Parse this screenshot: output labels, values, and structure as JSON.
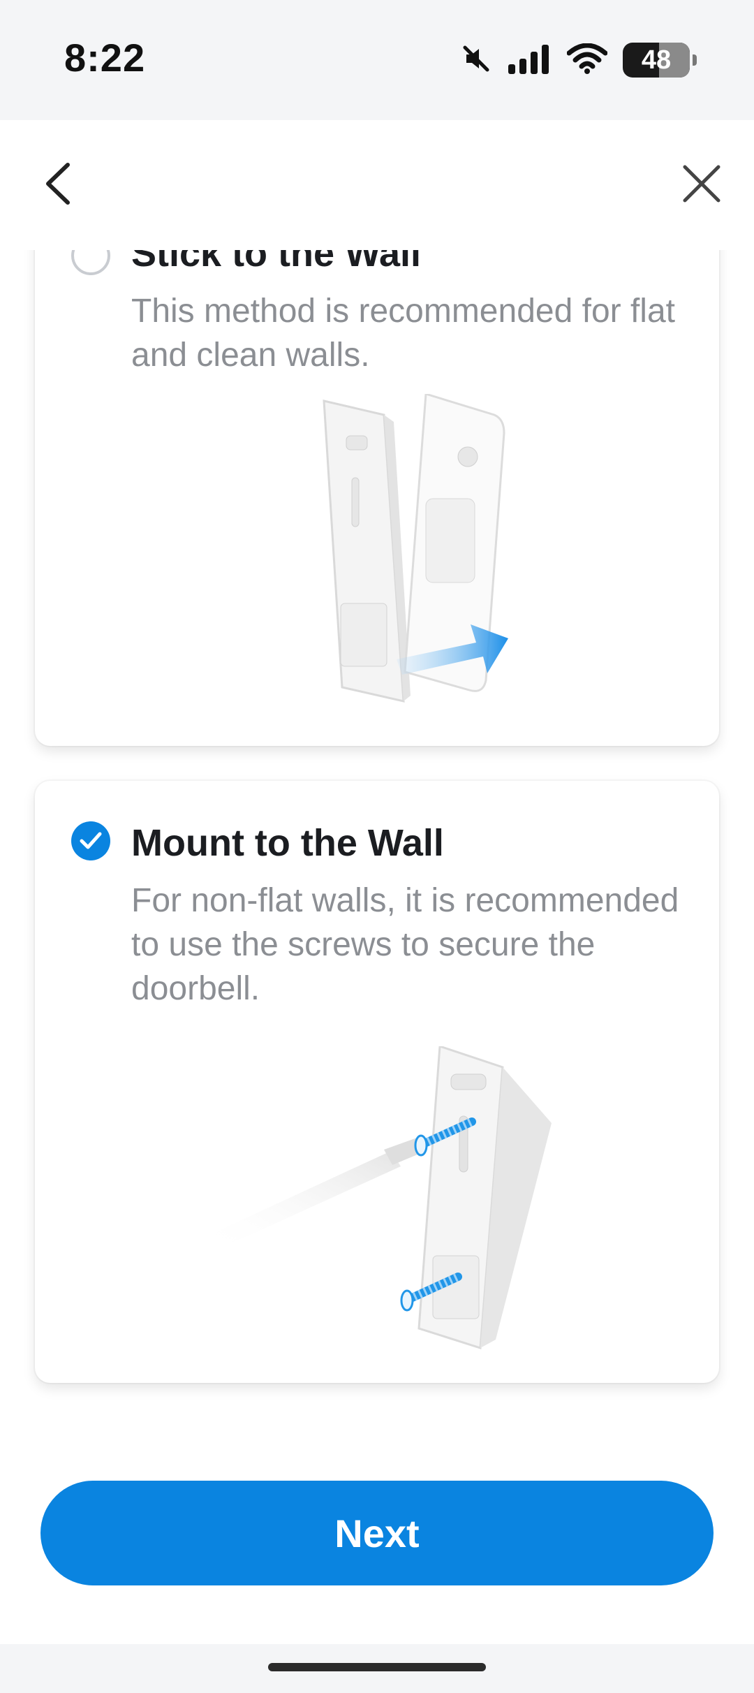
{
  "status_bar": {
    "time": "8:22",
    "battery": "48",
    "icons": [
      "mute-icon",
      "signal-icon",
      "wifi-icon",
      "battery-icon"
    ]
  },
  "nav": {
    "back_icon": "chevron-left-icon",
    "close_icon": "close-icon"
  },
  "options": [
    {
      "title": "Stick to the Wall",
      "description": "This method is recommended for flat and clean walls.",
      "selected": false
    },
    {
      "title": "Mount to the Wall",
      "description": "For non-flat walls, it is recommended to use the screws to secure the doorbell.",
      "selected": true
    }
  ],
  "footer": {
    "next_label": "Next"
  },
  "colors": {
    "accent": "#0a84e0",
    "text_primary": "#1b1d21",
    "text_secondary": "#8b8e93"
  }
}
